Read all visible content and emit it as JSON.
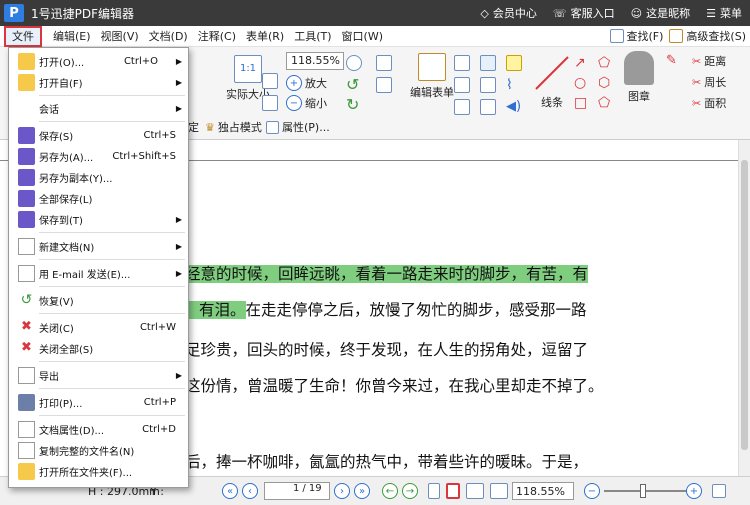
{
  "app": {
    "logo": "P",
    "title": "1号迅捷PDF编辑器",
    "member": "会员中心",
    "service": "客服入口",
    "nickname": "这是昵称",
    "menu": "菜单"
  },
  "menubar": [
    "文件",
    "编辑(E)",
    "视图(V)",
    "文档(D)",
    "注释(C)",
    "表单(R)",
    "工具(T)",
    "窗口(W)"
  ],
  "findbar": {
    "find": "查找(F)",
    "advanced": "高级查找(S)"
  },
  "ribbon": {
    "actual_size": "实际大小",
    "zoom_value": "118.55%",
    "zoom_in": "放大",
    "zoom_out": "缩小",
    "edit_form": "编辑表单",
    "lines": "线条",
    "stamp": "图章",
    "distance": "距离",
    "perimeter": "周长",
    "area": "面积",
    "exclusive": "独占模式",
    "properties": "属性(P)...",
    "fixed": "定"
  },
  "file_menu": [
    {
      "label": "打开(O)...",
      "key": "Ctrl+O",
      "arrow": "▶"
    },
    {
      "label": "打开自(F)",
      "key": "",
      "arrow": "▶"
    },
    {
      "label": "会话",
      "key": "",
      "arrow": "▶"
    },
    {
      "label": "保存(S)",
      "key": "Ctrl+S",
      "arrow": ""
    },
    {
      "label": "另存为(A)...",
      "key": "Ctrl+Shift+S",
      "arrow": ""
    },
    {
      "label": "另存为副本(Y)...",
      "key": "",
      "arrow": ""
    },
    {
      "label": "全部保存(L)",
      "key": "",
      "arrow": ""
    },
    {
      "label": "保存到(T)",
      "key": "",
      "arrow": "▶"
    },
    {
      "label": "新建文档(N)",
      "key": "",
      "arrow": "▶"
    },
    {
      "label": "用 E-mail 发送(E)...",
      "key": "",
      "arrow": "▶"
    },
    {
      "label": "恢复(V)",
      "key": "",
      "arrow": ""
    },
    {
      "label": "关闭(C)",
      "key": "Ctrl+W",
      "arrow": ""
    },
    {
      "label": "关闭全部(S)",
      "key": "",
      "arrow": ""
    },
    {
      "label": "导出",
      "key": "",
      "arrow": "▶"
    },
    {
      "label": "打印(P)...",
      "key": "Ctrl+P",
      "arrow": ""
    },
    {
      "label": "文档属性(D)...",
      "key": "Ctrl+D",
      "arrow": ""
    },
    {
      "label": "复制完整的文件名(N)",
      "key": "",
      "arrow": ""
    },
    {
      "label": "打开所在文件夹(F)...",
      "key": "",
      "arrow": ""
    }
  ],
  "document": {
    "lines": [
      {
        "hl": "经意的时候，回眸远眺，看着一路走来时的脚步，有苦，有",
        "rest": ""
      },
      {
        "hl": "有泪。",
        "rest": "在走走停停之后，放慢了匆忙的脚步，感受那一路"
      },
      {
        "hl": "",
        "rest": "足珍贵，回头的时候，终于发现，在人生的拐角处，逗留了"
      },
      {
        "hl": "",
        "rest": "这份情，曾温暖了生命！你曾今来过，在我心里却走不掉了。"
      },
      {
        "hl": "",
        "rest": "后，捧一杯咖啡，氤氲的热气中，带着些许的暖昧。于是，"
      }
    ]
  },
  "statusbar": {
    "height": "H : 297.0mm",
    "y": "Y :",
    "page_current": "1",
    "page_total": "/ 19",
    "zoom": "118.55%"
  },
  "colors": {
    "accent": "#2f7de1",
    "highlight": "#7fce7f",
    "titlebar": "#3a3a3a",
    "active_border": "#d9363e"
  }
}
